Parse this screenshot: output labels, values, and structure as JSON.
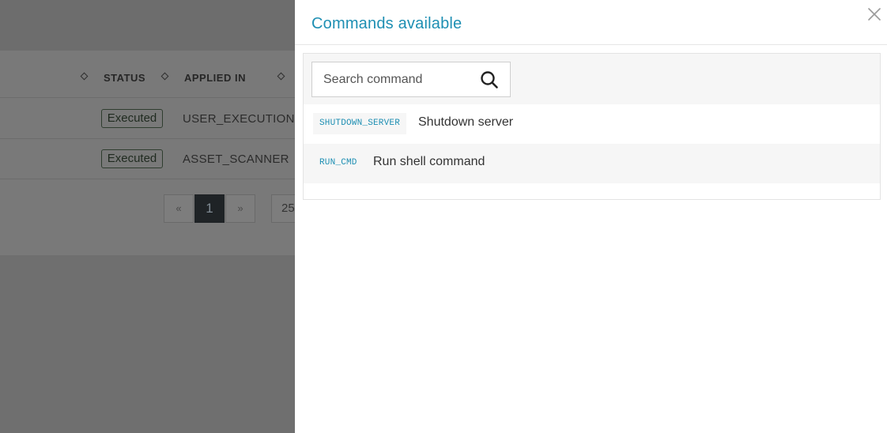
{
  "background_table": {
    "columns": [
      "STATUS",
      "APPLIED IN"
    ],
    "rows": [
      {
        "status": "Executed",
        "applied_in": "USER_EXECUTION"
      },
      {
        "status": "Executed",
        "applied_in": "ASSET_SCANNER"
      }
    ],
    "pagination": {
      "prev_label": "«",
      "current_page": "1",
      "next_label": "»",
      "page_size": "25"
    }
  },
  "drawer": {
    "title": "Commands available",
    "search": {
      "placeholder": "Search command",
      "value": ""
    },
    "commands": [
      {
        "code": "SHUTDOWN_SERVER",
        "description": "Shutdown server"
      },
      {
        "code": "RUN_CMD",
        "description": "Run shell command"
      }
    ]
  },
  "colors": {
    "accent": "#1e8fb3",
    "overlay": "#797979",
    "active_page": "#1f2326"
  },
  "icons": [
    "sort-icon",
    "close-icon",
    "search-icon"
  ]
}
